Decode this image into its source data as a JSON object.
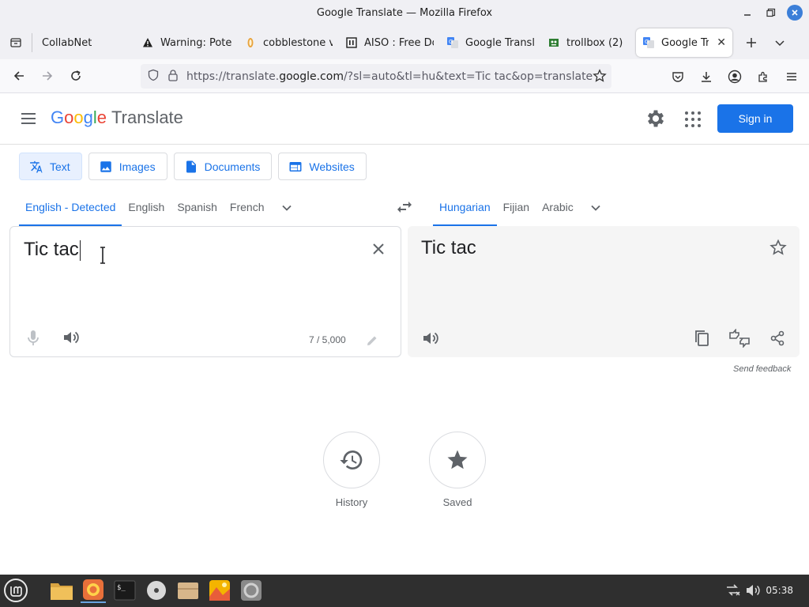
{
  "window": {
    "title": "Google Translate — Mozilla Firefox"
  },
  "tabs": [
    {
      "label": "CollabNet",
      "icon": "none"
    },
    {
      "label": "Warning: Pote",
      "icon": "warning-icon"
    },
    {
      "label": "cobblestone v",
      "icon": "cobblestone-icon"
    },
    {
      "label": "AISO : Free Do",
      "icon": "aiso-icon"
    },
    {
      "label": "Google Transl",
      "icon": "google-translate-icon"
    },
    {
      "label": "trollbox (2)",
      "icon": "trollbox-icon"
    },
    {
      "label": "Google Tran",
      "icon": "google-translate-icon",
      "active": true
    }
  ],
  "urlbar": {
    "prefix": "https://translate.",
    "host": "google.com",
    "suffix": "/?sl=auto&tl=hu&text=Tic tac&op=translate"
  },
  "header": {
    "logo_google": [
      "G",
      "o",
      "o",
      "g",
      "l",
      "e"
    ],
    "logo_product": "Translate",
    "signin": "Sign in"
  },
  "modes": [
    {
      "label": "Text",
      "icon": "translate-icon",
      "active": true
    },
    {
      "label": "Images",
      "icon": "image-icon"
    },
    {
      "label": "Documents",
      "icon": "document-icon"
    },
    {
      "label": "Websites",
      "icon": "website-icon"
    }
  ],
  "source_langs": [
    "English - Detected",
    "English",
    "Spanish",
    "French"
  ],
  "target_langs": [
    "Hungarian",
    "Fijian",
    "Arabic"
  ],
  "source": {
    "text": "Tic tac",
    "char_count": "7 / 5,000"
  },
  "target": {
    "text": "Tic tac"
  },
  "send_feedback": "Send feedback",
  "actions": {
    "history": "History",
    "saved": "Saved"
  },
  "taskbar": {
    "clock": "05:38"
  },
  "colors": {
    "accent": "#1a73e8",
    "active_tab_bg": "#e8f0fe",
    "taskbar": "#2f2f2f"
  }
}
